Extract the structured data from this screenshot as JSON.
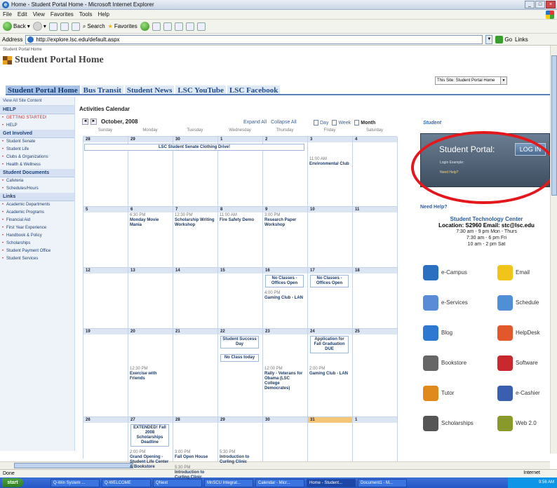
{
  "window": {
    "title": "Home - Student Portal Home - Microsoft Internet Explorer"
  },
  "menu": [
    "File",
    "Edit",
    "View",
    "Favorites",
    "Tools",
    "Help"
  ],
  "toolbar": {
    "back": "Back",
    "search": "Search",
    "favorites": "Favorites"
  },
  "address": {
    "label": "Address",
    "url": "http://explore.lsc.edu/default.aspx",
    "go": "Go",
    "links": "Links"
  },
  "page": {
    "breadcrumb": "Student Portal Home",
    "site_title": "Student Portal Home",
    "site_search": "This Site: Student Portal Home",
    "tabs": [
      "Student Portal Home",
      "Bus Transit",
      "Student News",
      "LSC YouTube",
      "LSC Facebook"
    ]
  },
  "leftnav": {
    "view_all": "View All Site Content",
    "sections": [
      {
        "heading": "HELP",
        "items": [
          "GETTING STARTED!",
          "HELP"
        ]
      },
      {
        "heading": "Get Involved",
        "items": [
          "Student Senate",
          "Student Life",
          "Clubs & Organizations",
          "Health & Wellness"
        ]
      },
      {
        "heading": "Student Documents",
        "items": [
          "Cafeteria",
          "Schedules/Hours"
        ]
      },
      {
        "heading": "Links",
        "items": [
          "Academic Departments",
          "Academic Programs",
          "Financial Aid",
          "First Year Experience",
          "Handbook & Policy",
          "Scholarships",
          "Student Payment Office",
          "Student Services"
        ]
      }
    ]
  },
  "calendar": {
    "title": "Activities Calendar",
    "month": "October, 2008",
    "expand_all": "Expand All",
    "collapse_all": "Collapse All",
    "views": [
      "Day",
      "Week",
      "Month"
    ],
    "days": [
      "Sunday",
      "Monday",
      "Tuesday",
      "Wednesday",
      "Thursday",
      "Friday",
      "Saturday"
    ],
    "weeks": [
      [
        "28",
        "29",
        "30",
        "1",
        "2",
        "3",
        "4"
      ],
      [
        "5",
        "6",
        "7",
        "8",
        "9",
        "10",
        "11"
      ],
      [
        "12",
        "13",
        "14",
        "15",
        "16",
        "17",
        "18"
      ],
      [
        "19",
        "20",
        "21",
        "22",
        "23",
        "24",
        "25"
      ],
      [
        "26",
        "27",
        "28",
        "29",
        "30",
        "31",
        "1"
      ]
    ],
    "today": "31",
    "banner": "LSC Student Senate Clothing Drive!",
    "events": {
      "env_club": {
        "time": "11:00 AM",
        "title": "Environmental Club"
      },
      "movie": {
        "time": "6:30 PM",
        "title": "Monday Movie Mania"
      },
      "scholarship": {
        "time": "12:30 PM",
        "title": "Scholarship Writing Workshop"
      },
      "fire": {
        "time": "11:00 AM",
        "title": "Fire Safety Demo"
      },
      "research": {
        "time": "3:00 PM",
        "title": "Research Paper Workshop"
      },
      "no_classes_16": "No Classes - Offices Open",
      "no_classes_17": "No Classes - Offices Open",
      "gaming_16": {
        "time": "4:00 PM",
        "title": "Gaming Club - LAN"
      },
      "success_day": "Student Success Day",
      "no_class_today": "No Class today",
      "fall_grad": "Application for Fall Graduation DUE",
      "exercise": {
        "time": "12:30 PM",
        "title": "Exercise with Friends"
      },
      "rally": {
        "time": "12:00 PM",
        "title": "Rally - Veterans for Obama (LSC College Democrates)"
      },
      "gaming_24": {
        "time": "2:00 PM",
        "title": "Gaming Club - LAN"
      },
      "extended": "EXTENDED! Fall 2008 Scholarships Deadline",
      "grand_opening": {
        "time": "2:00 PM",
        "title": "Grand Opening - Student Life Center & Bookstore"
      },
      "open_house": {
        "time": "3:00 PM",
        "title": "Fall Open House"
      },
      "curling_28": {
        "time": "5:30 PM",
        "title": "Introduction to Curling Clinic"
      },
      "curling_29": {
        "time": "5:30 PM",
        "title": "Introduction to Curling Clinic"
      }
    }
  },
  "portal": {
    "head": "Student",
    "title": "Student Portal:",
    "login": "LOG IN",
    "example": "Login Example: ",
    "need_help_small": "Need Help?"
  },
  "help": {
    "need_help": "Need Help?",
    "center": "Student Technology Center",
    "location": "Location: S2960 Email: stc@lsc.edu",
    "hours": [
      "7:30 am - 9 pm Mon - Thurs",
      "7:30 am - 6 pm Fri",
      "10 am - 2 pm Sat"
    ]
  },
  "services": [
    {
      "name": "e-Campus",
      "icon": "connect-icon",
      "color": "#2a6fc0"
    },
    {
      "name": "Email",
      "icon": "envelope-icon",
      "color": "#f0c419"
    },
    {
      "name": "e-Services",
      "icon": "eservices-icon",
      "color": "#5a8bd6"
    },
    {
      "name": "Schedule",
      "icon": "calendar-icon",
      "color": "#4f8fd8"
    },
    {
      "name": "Blog",
      "icon": "blog-icon",
      "color": "#2f78d1"
    },
    {
      "name": "HelpDesk",
      "icon": "question-icon",
      "color": "#e3582a"
    },
    {
      "name": "Bookstore",
      "icon": "books-icon",
      "color": "#666666"
    },
    {
      "name": "Software",
      "icon": "software-icon",
      "color": "#c8282e"
    },
    {
      "name": "Tutor",
      "icon": "tutor-icon",
      "color": "#e08a1e"
    },
    {
      "name": "e-Cashier",
      "icon": "cashier-icon",
      "color": "#3a5fb0"
    },
    {
      "name": "Scholarships",
      "icon": "pen-icon",
      "color": "#555555"
    },
    {
      "name": "Web 2.0",
      "icon": "web20-icon",
      "color": "#8a9a2a"
    }
  ],
  "status": {
    "done": "Done",
    "zone": "Internet"
  },
  "taskbar": {
    "start": "start",
    "items": [
      "Q-Win System ...",
      "Q-WELCOME",
      "QNext",
      "MnSCU Integrat...",
      "Calendar - Micr...",
      "Home - Student...",
      "Document1 - M..."
    ],
    "clock": "9:56 AM"
  }
}
